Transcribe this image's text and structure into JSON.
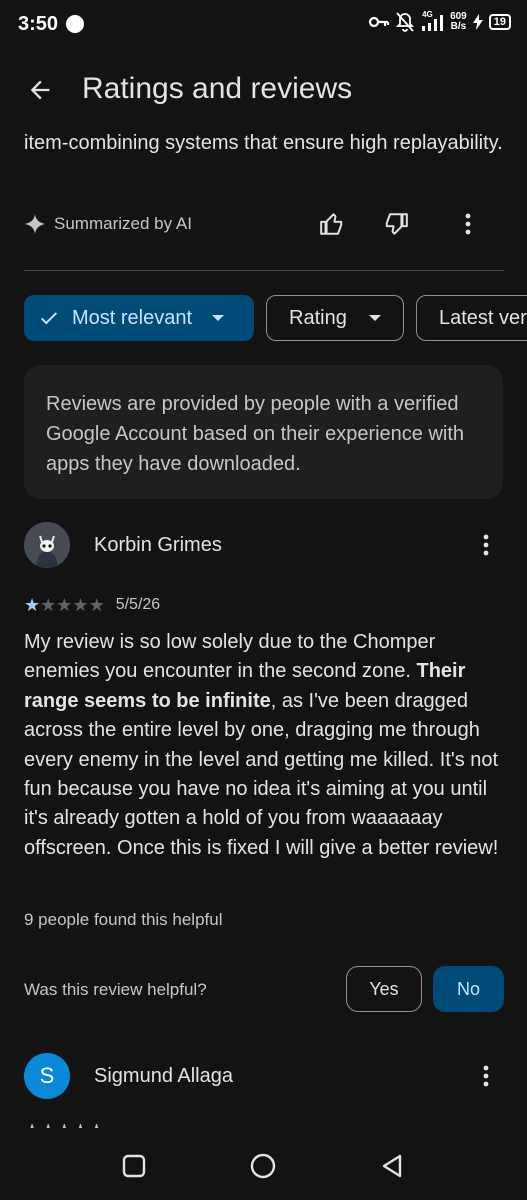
{
  "status_bar": {
    "time": "3:50",
    "net_type": "4G",
    "net_speed_value": "609",
    "net_speed_unit": "B/s",
    "battery": "19"
  },
  "header": {
    "title": "Ratings and reviews"
  },
  "summary": {
    "text": "item-combining systems that ensure high replayability.",
    "ai_label": "Summarized by AI"
  },
  "filters": {
    "most_relevant": "Most relevant",
    "rating": "Rating",
    "latest": "Latest version"
  },
  "info": {
    "text": "Reviews are provided by people with a verified Google Account based on their experience with apps they have downloaded."
  },
  "reviews": [
    {
      "name": "Korbin Grimes",
      "rating": 1,
      "date": "5/5/26",
      "text_part1": "My review is so low solely due to the Chomper enemies you encounter in the second zone. ",
      "text_bold": "Their range seems to be infinite",
      "text_part2": ", as I've been dragged across the entire level by one, dragging me through every enemy in the level and getting me killed. It's not fun because you have no idea it's aiming at you until it's already gotten a hold of you from waaaaaay offscreen. Once this is fixed I will give a better review!",
      "helpful_count": "9 people found this helpful",
      "helpful_question": "Was this review helpful?",
      "yes_label": "Yes",
      "no_label": "No"
    },
    {
      "name": "Sigmund Allaga",
      "avatar_letter": "S"
    }
  ],
  "colors": {
    "background": "#131314",
    "accent_chip": "#004a77",
    "accent_text": "#c2e7ff",
    "star_filled": "#a8c7fa",
    "star_empty": "#5f6368"
  }
}
